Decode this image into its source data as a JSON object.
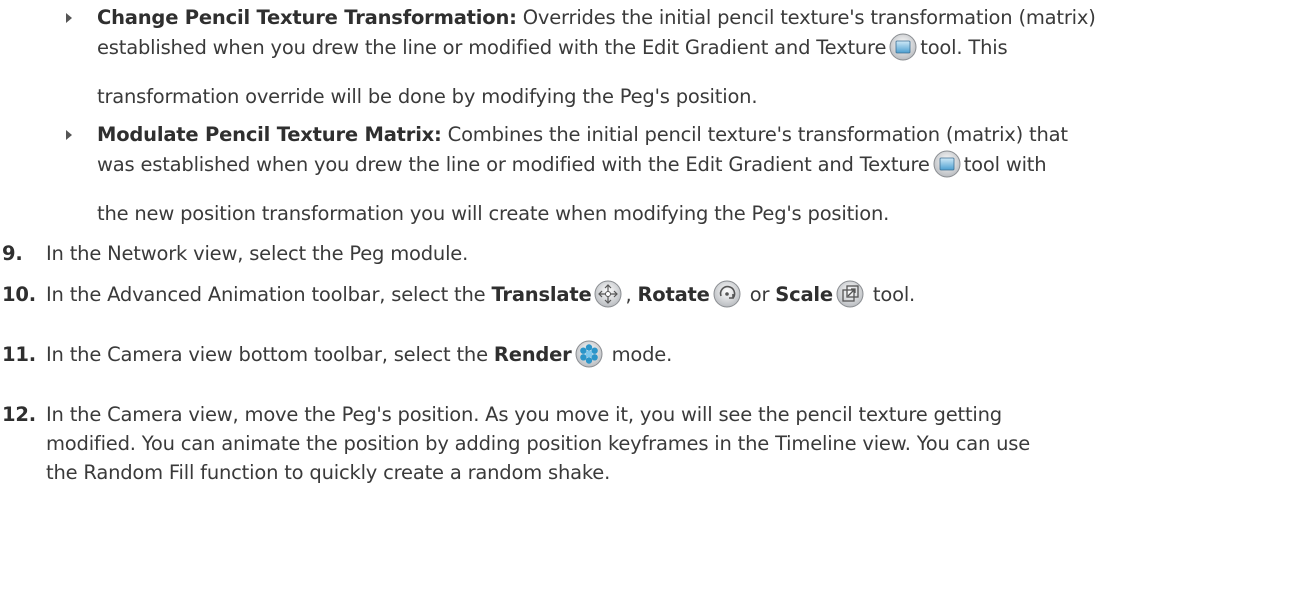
{
  "bullet1": {
    "title": "Change Pencil Texture Transformation:",
    "line1_rest": " Overrides the initial pencil texture's transformation (matrix)",
    "line2_pre": "established when you drew the line or modified with the Edit Gradient and Texture",
    "line2_post": "tool. This",
    "line3": "transformation override will be done by modifying the Peg's position."
  },
  "bullet2": {
    "title": "Modulate Pencil Texture Matrix:",
    "line1_rest": " Combines the initial pencil texture's transformation (matrix) that",
    "line2_pre": "was established when you drew the line or modified with the Edit Gradient and Texture",
    "line2_post": "tool with",
    "line3": "the new position transformation you will create when modifying the Peg's position."
  },
  "step9": {
    "num": "9.",
    "text": "In the Network view, select the Peg module."
  },
  "step10": {
    "num": "10.",
    "pre": "In the Advanced Animation toolbar, select the ",
    "translate": "Translate",
    "sep1": ", ",
    "rotate": "Rotate",
    "sep2": " or ",
    "scale": "Scale",
    "post": " tool."
  },
  "step11": {
    "num": "11.",
    "pre": "In the Camera view bottom toolbar, select the ",
    "render": "Render",
    "post": " mode."
  },
  "step12": {
    "num": "12.",
    "line1": "In the Camera view, move the Peg's position. As you move it, you will see the pencil texture getting",
    "line2": "modified. You can animate the position by adding position keyframes in the Timeline view. You can use",
    "line3": "the Random Fill function to quickly create a random shake."
  },
  "icons": [
    "edit-gradient-texture-icon",
    "translate-icon",
    "rotate-icon",
    "scale-icon",
    "render-icon"
  ]
}
